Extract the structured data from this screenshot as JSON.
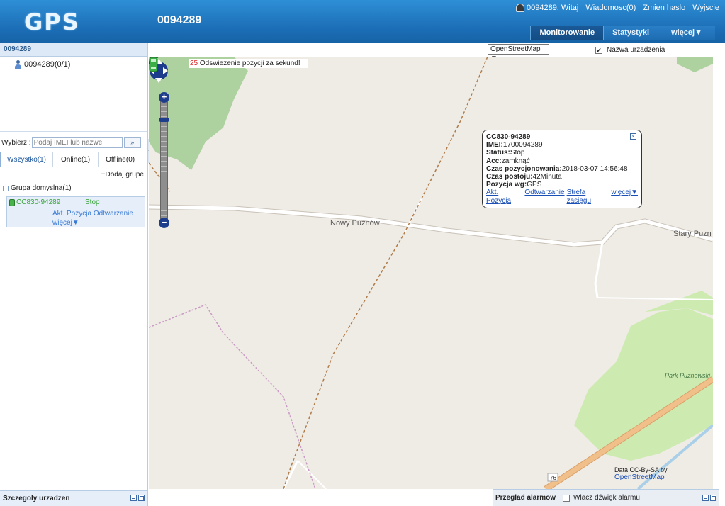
{
  "header": {
    "logo": "GPS",
    "device_title": "0094289",
    "user_greeting": "0094289, Witaj",
    "messages": "Wiadomosc(0)",
    "change_password": "Zmien haslo",
    "logout": "Wyjscie",
    "tabs": [
      {
        "label": "Monitorowanie",
        "active": true
      },
      {
        "label": "Statystyki",
        "active": false
      },
      {
        "label": "więcej▼",
        "active": false
      }
    ]
  },
  "sidebar": {
    "account": "0094289",
    "tree_node": "0094289(0/1)",
    "select_label": "Wybierz :",
    "search_placeholder": "Podaj IMEI lub nazwe",
    "tabs": [
      "Wszystko(1)",
      "Online(1)",
      "Offline(0)"
    ],
    "add_group": "+Dodaj grupe",
    "group_name": "Grupa domyslna(1)",
    "device": {
      "name": "CC830-94289",
      "status": "Stop",
      "link_position": "Akt. Pozycja",
      "link_playback": "Odtwarzanie",
      "link_more": "więcej▼"
    },
    "footer_title": "Szczegoly urzadzen"
  },
  "map": {
    "provider": "OpenStreetMap ▼",
    "show_names_label": "Nazwa urzadzenia",
    "show_names_checked": true,
    "refresh_seconds": "25",
    "refresh_text": " Odswiezenie pozycji za sekund!",
    "zoom_in": "+",
    "zoom_out": "−",
    "labels": {
      "town1": "Nowy Puznów",
      "town2": "Stary Puzn",
      "park": "Park Puznowski",
      "road": "76"
    },
    "attribution_prefix": "Data CC-By-SA by ",
    "attribution_link": "OpenStreetMap"
  },
  "popup": {
    "title": "CC830-94289",
    "rows": [
      {
        "label": "IMEI:",
        "value": "1700094289"
      },
      {
        "label": "Status:",
        "value": "Stop"
      },
      {
        "label": "Acc:",
        "value": "zamknąć"
      },
      {
        "label": "Czas pozycjonowania:",
        "value": "2018-03-07 14:56:48"
      },
      {
        "label": "Czas postoju:",
        "value": "42Minuta"
      },
      {
        "label": "Pozycja wg:",
        "value": "GPS"
      }
    ],
    "links": [
      "Akt. Pozycja",
      "Odtwarzanie",
      "Strefa zasięgu",
      "więcej▼"
    ]
  },
  "alarm": {
    "title": "Przeglad alarmow",
    "sound_label": "Wlacz dźwięk alarmu"
  }
}
